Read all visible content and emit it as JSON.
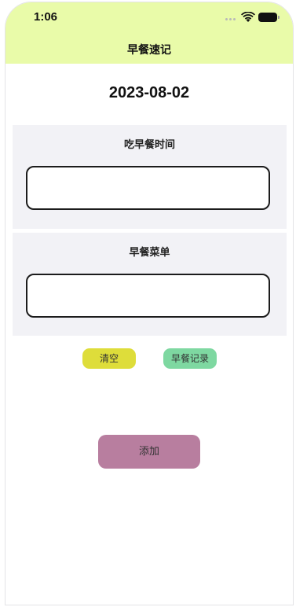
{
  "status_bar": {
    "time": "1:06"
  },
  "nav": {
    "title": "早餐速记"
  },
  "date": "2023-08-02",
  "form": {
    "time_label": "吃早餐时间",
    "time_value": "",
    "menu_label": "早餐菜单",
    "menu_value": ""
  },
  "buttons": {
    "clear": "清空",
    "record": "早餐记录",
    "add": "添加"
  },
  "colors": {
    "header_bg": "#e9fba9",
    "card_bg": "#f2f2f6",
    "clear_button": "#dedd3a",
    "record_button": "#7ed8a1",
    "add_button": "#b87e9f"
  },
  "icons": {
    "signal": "signal-dots-icon",
    "wifi": "wifi-icon",
    "battery": "battery-icon"
  }
}
